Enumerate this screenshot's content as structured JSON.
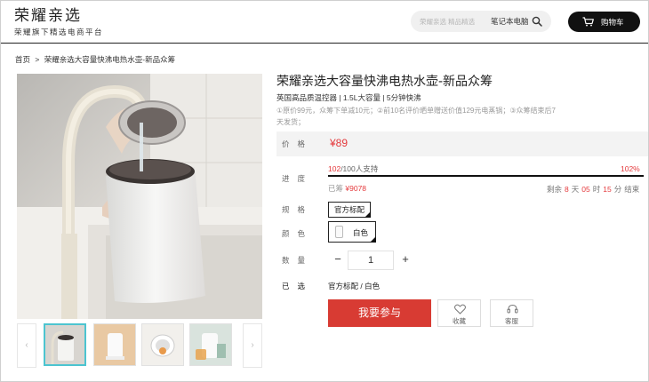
{
  "header": {
    "logo_main": "荣耀亲选",
    "logo_sub": "荣耀旗下精选电商平台",
    "search_placeholder": "荣耀亲选 精品精选",
    "search_keyword": "笔记本电脑",
    "cart_label": "购物车"
  },
  "breadcrumb": {
    "home": "首页",
    "separator": ">",
    "current": "荣耀亲选大容量快沸电热水壶-新品众筹"
  },
  "product": {
    "title": "荣耀亲选大容量快沸电热水壶-新品众筹",
    "subtitle": "英国高品质温控器 | 1.5L大容量 | 5分钟快沸",
    "description": "①原价99元，众筹下单减10元；②前10名评价晒单赠送价值129元电蒸锅；③众筹结束后7天发货；"
  },
  "price": {
    "label": "价格",
    "value": "¥89"
  },
  "progress": {
    "label": "进度",
    "supporters": "102",
    "goal_text": "/100人支持",
    "percent_text": "102%",
    "percent_value": 102,
    "raised_prefix": "已筹",
    "raised_amount": "¥9078",
    "countdown": {
      "prefix": "剩余",
      "days": "8",
      "days_unit": "天",
      "hours": "05",
      "hours_unit": "时",
      "minutes": "15",
      "minutes_unit": "分",
      "suffix": "结束"
    }
  },
  "spec": {
    "label": "规格",
    "option": "官方标配"
  },
  "color": {
    "label": "颜色",
    "option": "白色"
  },
  "quantity": {
    "label": "数量",
    "value": "1",
    "minus": "−",
    "plus": "+"
  },
  "selected": {
    "label": "已选",
    "value": "官方标配 / 白色"
  },
  "actions": {
    "buy": "我要参与",
    "favorite": "收藏",
    "service": "客服"
  },
  "gallery": {
    "prev": "‹",
    "next": "›",
    "thumbnails": [
      "kettle-pour",
      "kettle-white",
      "kettle-top",
      "kettle-glass"
    ]
  },
  "colors": {
    "accent": "#e4393c",
    "buy_button": "#d83b33",
    "thumb_active": "#4cc4d0"
  }
}
